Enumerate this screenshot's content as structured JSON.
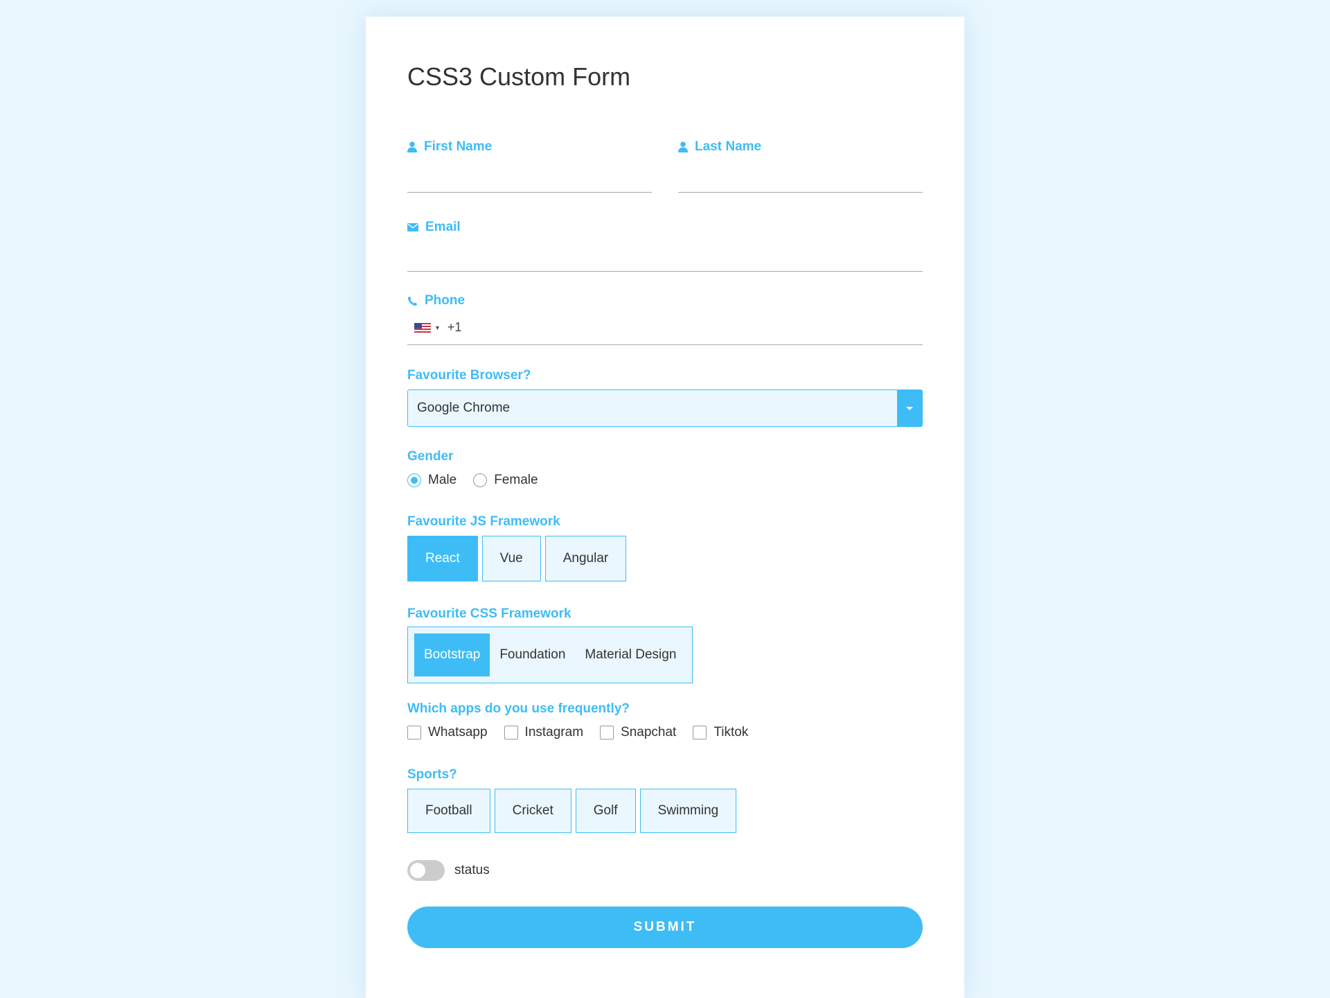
{
  "form": {
    "title": "CSS3 Custom Form",
    "first_name": {
      "label": "First Name",
      "icon": "user-icon",
      "value": ""
    },
    "last_name": {
      "label": "Last Name",
      "icon": "user-icon",
      "value": ""
    },
    "email": {
      "label": "Email",
      "icon": "envelope-icon",
      "value": ""
    },
    "phone": {
      "label": "Phone",
      "icon": "phone-icon",
      "country": "us-flag-icon",
      "dial_code": "+1",
      "value": ""
    },
    "browser": {
      "label": "Favourite Browser?",
      "selected": "Google Chrome"
    },
    "gender": {
      "label": "Gender",
      "options": [
        "Male",
        "Female"
      ],
      "selected": "Male"
    },
    "js_framework": {
      "label": "Favourite JS Framework",
      "options": [
        "React",
        "Vue",
        "Angular"
      ],
      "selected": "React"
    },
    "css_framework": {
      "label": "Favourite CSS Framework",
      "options": [
        "Bootstrap",
        "Foundation",
        "Material Design"
      ],
      "selected": "Bootstrap"
    },
    "apps": {
      "label": "Which apps do you use frequently?",
      "options": [
        "Whatsapp",
        "Instagram",
        "Snapchat",
        "Tiktok"
      ],
      "checked": []
    },
    "sports": {
      "label": "Sports?",
      "options": [
        "Football",
        "Cricket",
        "Golf",
        "Swimming"
      ]
    },
    "status": {
      "label": "status",
      "on": false
    },
    "submit_label": "SUBMIT"
  },
  "colors": {
    "accent": "#3ebcf6",
    "accent_light": "#eaf7fe",
    "page_background": "#e8f6fe",
    "text": "#333333"
  }
}
